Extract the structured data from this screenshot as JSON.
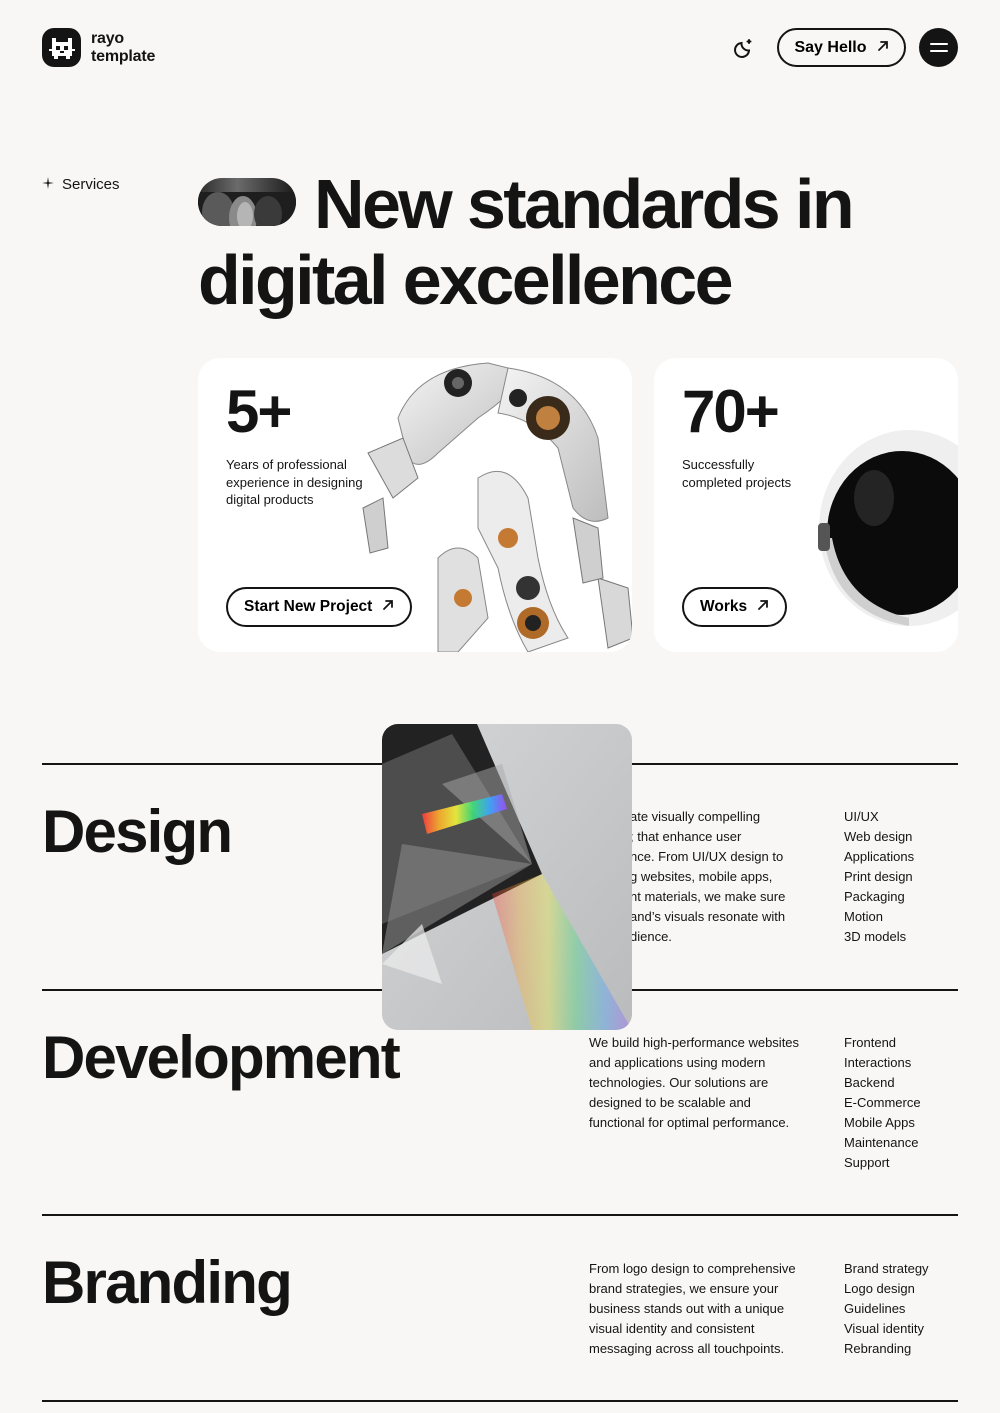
{
  "brand": {
    "name_line1": "rayo",
    "name_line2": "template"
  },
  "header": {
    "say_hello_label": "Say Hello",
    "icons": {
      "theme_toggle": "moon-sun-icon",
      "arrow": "arrow-up-right-icon",
      "menu": "hamburger-icon"
    }
  },
  "hero": {
    "section_label": "Services",
    "title_line1": "New standards in",
    "title_line2": "digital excellence"
  },
  "cards": [
    {
      "stat": "5+",
      "description": "Years of professional experience in designing digital products",
      "button_label": "Start New Project"
    },
    {
      "stat": "70+",
      "description": "Successfully completed projects",
      "button_label": "Works"
    }
  ],
  "services": [
    {
      "title": "Design",
      "description": "We create visually compelling designs that enhance user experience. From UI/UX design to stunning websites, mobile apps, and print materials, we make sure your brand’s visuals resonate with your audience.",
      "visible_description": "ate visually compelling\n; that enhance user\nnce. From UI/UX design to\ng websites, mobile apps,\nnt materials, we make sure\nand’s visuals resonate with\ndience.",
      "tags": [
        "UI/UX",
        "Web design",
        "Applications",
        "Print design",
        "Packaging",
        "Motion",
        "3D models"
      ]
    },
    {
      "title": "Development",
      "description": "We build high-performance websites and applications using modern technologies. Our solutions are designed to be scalable and functional for optimal performance.",
      "tags": [
        "Frontend",
        "Interactions",
        "Backend",
        "E-Commerce",
        "Mobile Apps",
        "Maintenance",
        "Support"
      ]
    },
    {
      "title": "Branding",
      "description": "From logo design to comprehensive brand strategies, we ensure your business stands out with a unique visual identity and consistent messaging across all touchpoints.",
      "tags": [
        "Brand strategy",
        "Logo design",
        "Guidelines",
        "Visual identity",
        "Rebranding"
      ]
    }
  ],
  "colors": {
    "background": "#f8f7f5",
    "text": "#141414",
    "card": "#ffffff"
  }
}
